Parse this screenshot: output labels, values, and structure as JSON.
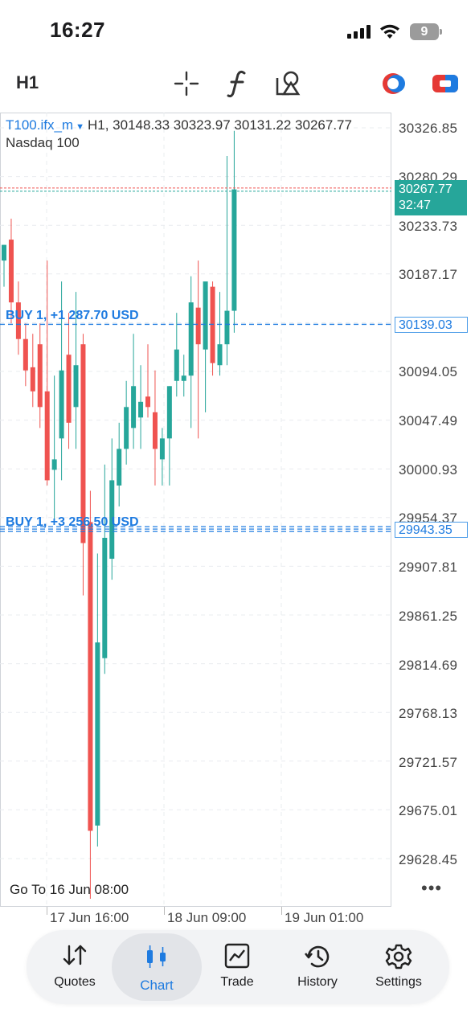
{
  "status_bar": {
    "time": "16:27",
    "battery": "9"
  },
  "toolbar": {
    "timeframe": "H1",
    "icons": [
      "crosshair-icon",
      "function-icon",
      "objects-icon",
      "trading-accounts-icon",
      "one-click-trading-icon"
    ]
  },
  "chart": {
    "symbol": "T100.ifx_m",
    "ohlc_text": "H1, 30148.33 30323.97 30131.22 30267.77",
    "description": "Nasdaq 100",
    "current_price": "30267.77",
    "countdown": "32:47",
    "price_labels": [
      "30326.85",
      "30280.29",
      "30233.73",
      "30187.17",
      "30139.03",
      "30094.05",
      "30047.49",
      "30000.93",
      "29954.37",
      "29943.35",
      "29907.81",
      "29861.25",
      "29814.69",
      "29768.13",
      "29721.57",
      "29675.01",
      "29628.45"
    ],
    "buy_line_1": {
      "label": "BUY 1, +1 287.70 USD",
      "price": "30139.03"
    },
    "buy_line_2": {
      "label": "BUY 1, +3 256.50 USD",
      "price": "29943.35"
    },
    "goto_text": "Go To 16 Jun 08:00",
    "more": "•••",
    "time_labels": [
      "17 Jun 16:00",
      "18 Jun 09:00",
      "19 Jun 01:00"
    ],
    "colors": {
      "bull": "#26a69a",
      "bear": "#ef5350",
      "buy_line": "#1e7be0"
    }
  },
  "chart_data": {
    "type": "candlestick",
    "ylim": [
      29600,
      30340
    ],
    "candles": [
      {
        "o": 30200,
        "h": 30215,
        "l": 30175,
        "c": 30215
      },
      {
        "o": 30220,
        "h": 30240,
        "l": 30140,
        "c": 30160
      },
      {
        "o": 30160,
        "h": 30180,
        "l": 30110,
        "c": 30125
      },
      {
        "o": 30125,
        "h": 30140,
        "l": 30080,
        "c": 30095
      },
      {
        "o": 30098,
        "h": 30130,
        "l": 30060,
        "c": 30075
      },
      {
        "o": 30120,
        "h": 30140,
        "l": 30040,
        "c": 30060
      },
      {
        "o": 30075,
        "h": 30200,
        "l": 29985,
        "c": 29990
      },
      {
        "o": 30000,
        "h": 30090,
        "l": 29950,
        "c": 30010
      },
      {
        "o": 30030,
        "h": 30180,
        "l": 29990,
        "c": 30095
      },
      {
        "o": 30110,
        "h": 30150,
        "l": 30020,
        "c": 30045
      },
      {
        "o": 30060,
        "h": 30170,
        "l": 30020,
        "c": 30100
      },
      {
        "o": 30120,
        "h": 30130,
        "l": 29880,
        "c": 29930
      },
      {
        "o": 29950,
        "h": 29980,
        "l": 29590,
        "c": 29655
      },
      {
        "o": 29660,
        "h": 29920,
        "l": 29640,
        "c": 29835
      },
      {
        "o": 29820,
        "h": 30005,
        "l": 29805,
        "c": 29935
      },
      {
        "o": 29915,
        "h": 30030,
        "l": 29895,
        "c": 29990
      },
      {
        "o": 29985,
        "h": 30045,
        "l": 29965,
        "c": 30020
      },
      {
        "o": 30020,
        "h": 30085,
        "l": 30005,
        "c": 30060
      },
      {
        "o": 30040,
        "h": 30130,
        "l": 30020,
        "c": 30080
      },
      {
        "o": 30050,
        "h": 30100,
        "l": 30020,
        "c": 30065
      },
      {
        "o": 30070,
        "h": 30120,
        "l": 30050,
        "c": 30060
      },
      {
        "o": 30055,
        "h": 30095,
        "l": 29985,
        "c": 30020
      },
      {
        "o": 30010,
        "h": 30040,
        "l": 29985,
        "c": 30030
      },
      {
        "o": 30030,
        "h": 30080,
        "l": 29985,
        "c": 30080
      },
      {
        "o": 30085,
        "h": 30150,
        "l": 30070,
        "c": 30115
      },
      {
        "o": 30085,
        "h": 30110,
        "l": 30070,
        "c": 30090
      },
      {
        "o": 30090,
        "h": 30185,
        "l": 30040,
        "c": 30160
      },
      {
        "o": 30155,
        "h": 30200,
        "l": 30030,
        "c": 30120
      },
      {
        "o": 30115,
        "h": 30165,
        "l": 30055,
        "c": 30180
      },
      {
        "o": 30175,
        "h": 30180,
        "l": 30090,
        "c": 30102
      },
      {
        "o": 30100,
        "h": 30170,
        "l": 30090,
        "c": 30120
      },
      {
        "o": 30120,
        "h": 30300,
        "l": 30100,
        "c": 30152
      },
      {
        "o": 30152,
        "h": 30324,
        "l": 30131,
        "c": 30268
      }
    ]
  },
  "bottom_nav": [
    {
      "label": "Quotes",
      "icon": "quotes-icon",
      "active": false
    },
    {
      "label": "Chart",
      "icon": "chart-icon",
      "active": true
    },
    {
      "label": "Trade",
      "icon": "trade-icon",
      "active": false
    },
    {
      "label": "History",
      "icon": "history-icon",
      "active": false
    },
    {
      "label": "Settings",
      "icon": "settings-icon",
      "active": false
    }
  ]
}
